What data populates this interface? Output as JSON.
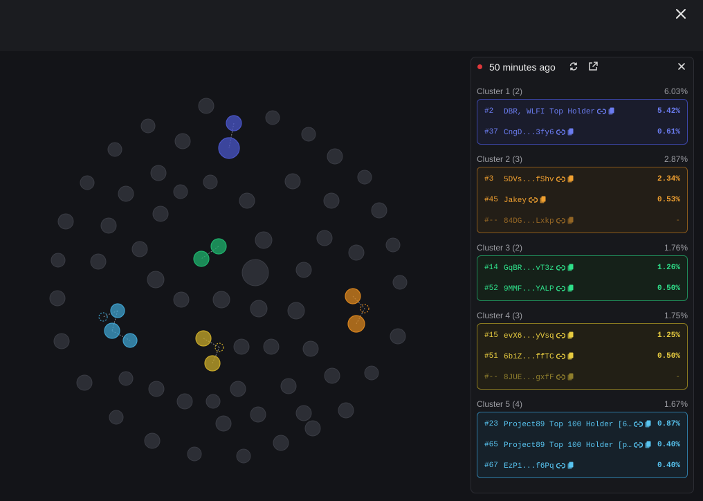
{
  "header": {
    "close_icon": "close-icon"
  },
  "panel": {
    "time_label": "50 minutes ago",
    "icons": [
      "refresh-icon",
      "external-link-icon",
      "close-icon"
    ],
    "clusters": [
      {
        "label": "Cluster 1 (2)",
        "percent": "6.03%",
        "color": "blue",
        "rows": [
          {
            "rank": "#2",
            "name": "DBR, WLFI Top Holder",
            "percent": "5.42%"
          },
          {
            "rank": "#37",
            "name": "CngD...3fy6",
            "percent": "0.61%"
          }
        ]
      },
      {
        "label": "Cluster 2 (3)",
        "percent": "2.87%",
        "color": "orange",
        "rows": [
          {
            "rank": "#3",
            "name": "5DVs...fShv",
            "percent": "2.34%"
          },
          {
            "rank": "#45",
            "name": "Jakey",
            "percent": "0.53%"
          },
          {
            "rank": "#--",
            "name": "84DG...Lxkp",
            "percent": "-"
          }
        ]
      },
      {
        "label": "Cluster 3 (2)",
        "percent": "1.76%",
        "color": "green",
        "rows": [
          {
            "rank": "#14",
            "name": "GqBR...vT3z",
            "percent": "1.26%"
          },
          {
            "rank": "#52",
            "name": "9MMF...YALP",
            "percent": "0.50%"
          }
        ]
      },
      {
        "label": "Cluster 4 (3)",
        "percent": "1.75%",
        "color": "yellow",
        "rows": [
          {
            "rank": "#15",
            "name": "evX6...yVsq",
            "percent": "1.25%"
          },
          {
            "rank": "#51",
            "name": "6biZ...ffTC",
            "percent": "0.50%"
          },
          {
            "rank": "#--",
            "name": "8JUE...gxfF",
            "percent": "-"
          }
        ]
      },
      {
        "label": "Cluster 5 (4)",
        "percent": "1.67%",
        "color": "cyan",
        "rows": [
          {
            "rank": "#23",
            "name": "Project89 Top 100 Holder [6…",
            "percent": "0.87%"
          },
          {
            "rank": "#65",
            "name": "Project89 Top 100 Holder [p…",
            "percent": "0.40%"
          },
          {
            "rank": "#67",
            "name": "EzP1...f6Pq",
            "percent": "0.40%"
          }
        ]
      }
    ]
  },
  "colors": {
    "background": "#131418",
    "node_gray": "#2c2e35",
    "blue": "#4a55c8",
    "orange": "#d8841e",
    "green": "#1fb26c",
    "yellow": "#c7a82a",
    "cyan": "#3fa0cc"
  }
}
